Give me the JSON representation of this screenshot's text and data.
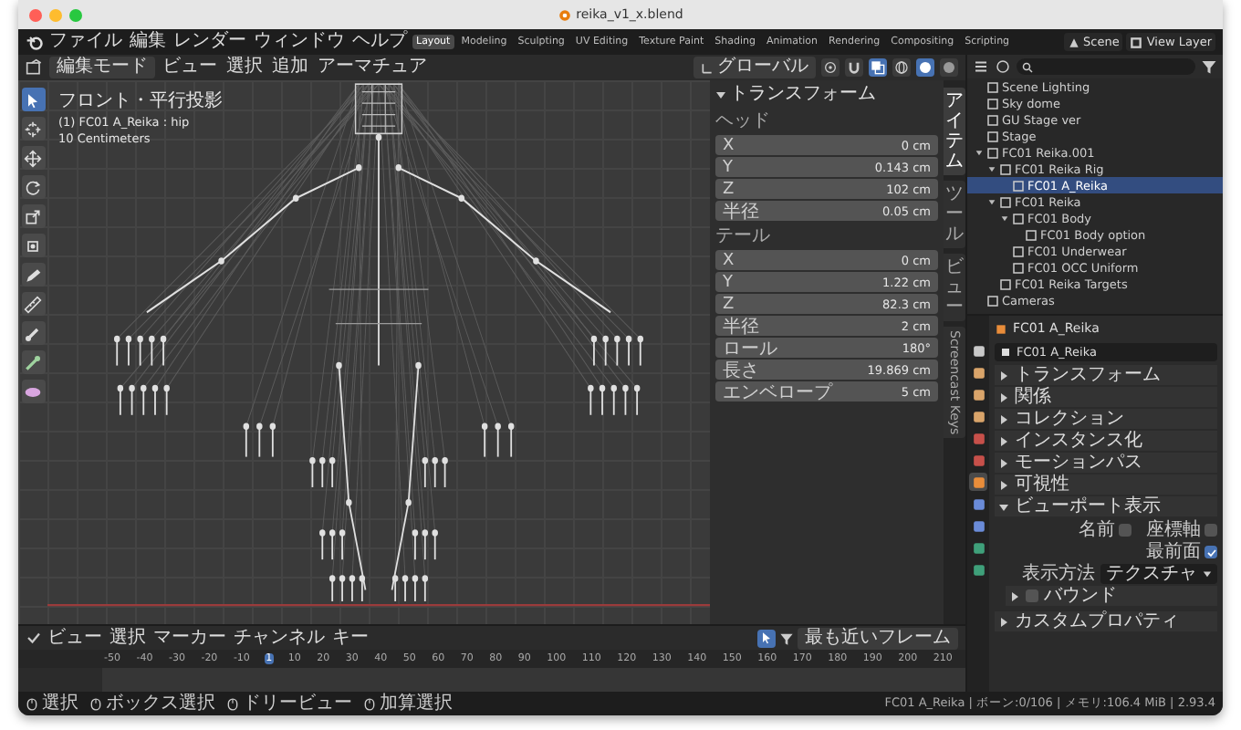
{
  "window": {
    "title": "reika_v1_x.blend"
  },
  "topbar": {
    "menus": [
      "ファイル",
      "編集",
      "レンダー",
      "ウィンドウ",
      "ヘルプ"
    ],
    "workspaces": [
      {
        "label": "Layout",
        "selected": true
      },
      {
        "label": "Modeling",
        "selected": false
      },
      {
        "label": "Sculpting",
        "selected": false
      },
      {
        "label": "UV Editing",
        "selected": false
      },
      {
        "label": "Texture Paint",
        "selected": false
      },
      {
        "label": "Shading",
        "selected": false
      },
      {
        "label": "Animation",
        "selected": false
      },
      {
        "label": "Rendering",
        "selected": false
      },
      {
        "label": "Compositing",
        "selected": false
      },
      {
        "label": "Scripting",
        "selected": false
      }
    ],
    "scene": "Scene",
    "view_layer": "View Layer"
  },
  "viewport": {
    "mode": "編集モード",
    "menus": [
      "ビュー",
      "選択",
      "追加",
      "アーマチュア"
    ],
    "orientation": "グローバル",
    "overlay": [
      "フロント・平行投影",
      "(1) FC01 A_Reika : hip",
      "10 Centimeters"
    ]
  },
  "sidebar": {
    "panel": "トランスフォーム",
    "sections": [
      {
        "title": "ヘッド",
        "rows": [
          {
            "label": "X",
            "value": "0 cm"
          },
          {
            "label": "Y",
            "value": "0.143 cm"
          },
          {
            "label": "Z",
            "value": "102 cm"
          },
          {
            "label": "半径",
            "value": "0.05 cm"
          }
        ]
      },
      {
        "title": "テール",
        "rows": [
          {
            "label": "X",
            "value": "0 cm"
          },
          {
            "label": "Y",
            "value": "1.22 cm"
          },
          {
            "label": "Z",
            "value": "82.3 cm"
          },
          {
            "label": "半径",
            "value": "2 cm"
          },
          {
            "label": "ロール",
            "value": "180°"
          },
          {
            "label": "長さ",
            "value": "19.869 cm"
          },
          {
            "label": "エンベロープ",
            "value": "5 cm"
          }
        ]
      }
    ],
    "tabs": [
      {
        "label": "アイテム",
        "kind": "cjk",
        "selected": true
      },
      {
        "label": "ツール",
        "kind": "cjk",
        "selected": false
      },
      {
        "label": "ビュー",
        "kind": "cjk",
        "selected": false
      },
      {
        "label": "Screencast Keys",
        "kind": "latin",
        "selected": false
      }
    ]
  },
  "outliner": {
    "items": [
      {
        "label": "Scene Lighting",
        "selected": false
      },
      {
        "label": "Sky dome",
        "selected": false
      },
      {
        "label": "GU Stage ver",
        "selected": false
      },
      {
        "label": "Stage",
        "selected": false
      },
      {
        "label": "FC01 Reika.001",
        "selected": false,
        "children": [
          {
            "label": "FC01 Reika Rig",
            "selected": false,
            "children": [
              {
                "label": "FC01 A_Reika",
                "selected": true
              }
            ]
          },
          {
            "label": "FC01 Reika",
            "selected": false,
            "children": [
              {
                "label": "FC01 Body",
                "selected": false,
                "children": [
                  {
                    "label": "FC01 Body option",
                    "selected": false
                  }
                ]
              },
              {
                "label": "FC01 Underwear",
                "selected": false
              },
              {
                "label": "FC01 OCC Uniform",
                "selected": false
              }
            ]
          },
          {
            "label": "FC01 Reika Targets",
            "selected": false
          }
        ]
      },
      {
        "label": "Cameras",
        "selected": false
      }
    ]
  },
  "properties": {
    "tabs": [
      {
        "selected": false
      },
      {
        "selected": false
      },
      {
        "selected": false
      },
      {
        "selected": false
      },
      {
        "selected": false
      },
      {
        "selected": false
      },
      {
        "selected": true
      },
      {
        "selected": false
      },
      {
        "selected": false
      },
      {
        "selected": false
      },
      {
        "selected": false
      }
    ],
    "object": "FC01 A_Reika",
    "name_field": "FC01 A_Reika",
    "panels": [
      {
        "label": "トランスフォーム",
        "expanded": false
      },
      {
        "label": "関係",
        "expanded": false
      },
      {
        "label": "コレクション",
        "expanded": false
      },
      {
        "label": "インスタンス化",
        "expanded": false
      },
      {
        "label": "モーションパス",
        "expanded": false
      },
      {
        "label": "可視性",
        "expanded": false
      },
      {
        "label": "ビューポート表示",
        "expanded": true,
        "rows": [
          {
            "kind": "checkbox",
            "label": "名前",
            "checked": false
          },
          {
            "kind": "checkbox",
            "label": "座標軸",
            "checked": false
          },
          {
            "kind": "checkbox",
            "label": "最前面",
            "checked": true
          },
          {
            "kind": "dropdown",
            "label": "表示方法",
            "value": "テクスチャ"
          },
          {
            "kind": "subpanel",
            "label": "バウンド"
          }
        ]
      },
      {
        "label": "カスタムプロパティ",
        "expanded": false
      }
    ]
  },
  "timeline": {
    "menus": [
      "ビュー",
      "選択",
      "マーカー",
      "チャンネル",
      "キー"
    ],
    "snapping": "最も近いフレーム",
    "frames": [
      {
        "label": "-50",
        "selected": false
      },
      {
        "label": "-40",
        "selected": false
      },
      {
        "label": "-30",
        "selected": false
      },
      {
        "label": "-20",
        "selected": false
      },
      {
        "label": "-10",
        "selected": false
      },
      {
        "label": "1",
        "selected": true
      },
      {
        "label": "10",
        "selected": false
      },
      {
        "label": "20",
        "selected": false
      },
      {
        "label": "30",
        "selected": false
      },
      {
        "label": "40",
        "selected": false
      },
      {
        "label": "50",
        "selected": false
      },
      {
        "label": "60",
        "selected": false
      },
      {
        "label": "70",
        "selected": false
      },
      {
        "label": "80",
        "selected": false
      },
      {
        "label": "90",
        "selected": false
      },
      {
        "label": "100",
        "selected": false
      },
      {
        "label": "110",
        "selected": false
      },
      {
        "label": "120",
        "selected": false
      },
      {
        "label": "130",
        "selected": false
      },
      {
        "label": "140",
        "selected": false
      },
      {
        "label": "150",
        "selected": false
      },
      {
        "label": "160",
        "selected": false
      },
      {
        "label": "170",
        "selected": false
      },
      {
        "label": "180",
        "selected": false
      },
      {
        "label": "190",
        "selected": false
      },
      {
        "label": "200",
        "selected": false
      },
      {
        "label": "210",
        "selected": false
      }
    ]
  },
  "status_bar": {
    "items": [
      "選択",
      "ボックス選択",
      "ドリービュー",
      "加算選択"
    ],
    "info": "FC01 A_Reika | ボーン:0/106 | メモリ:106.4 MiB | 2.93.4"
  }
}
